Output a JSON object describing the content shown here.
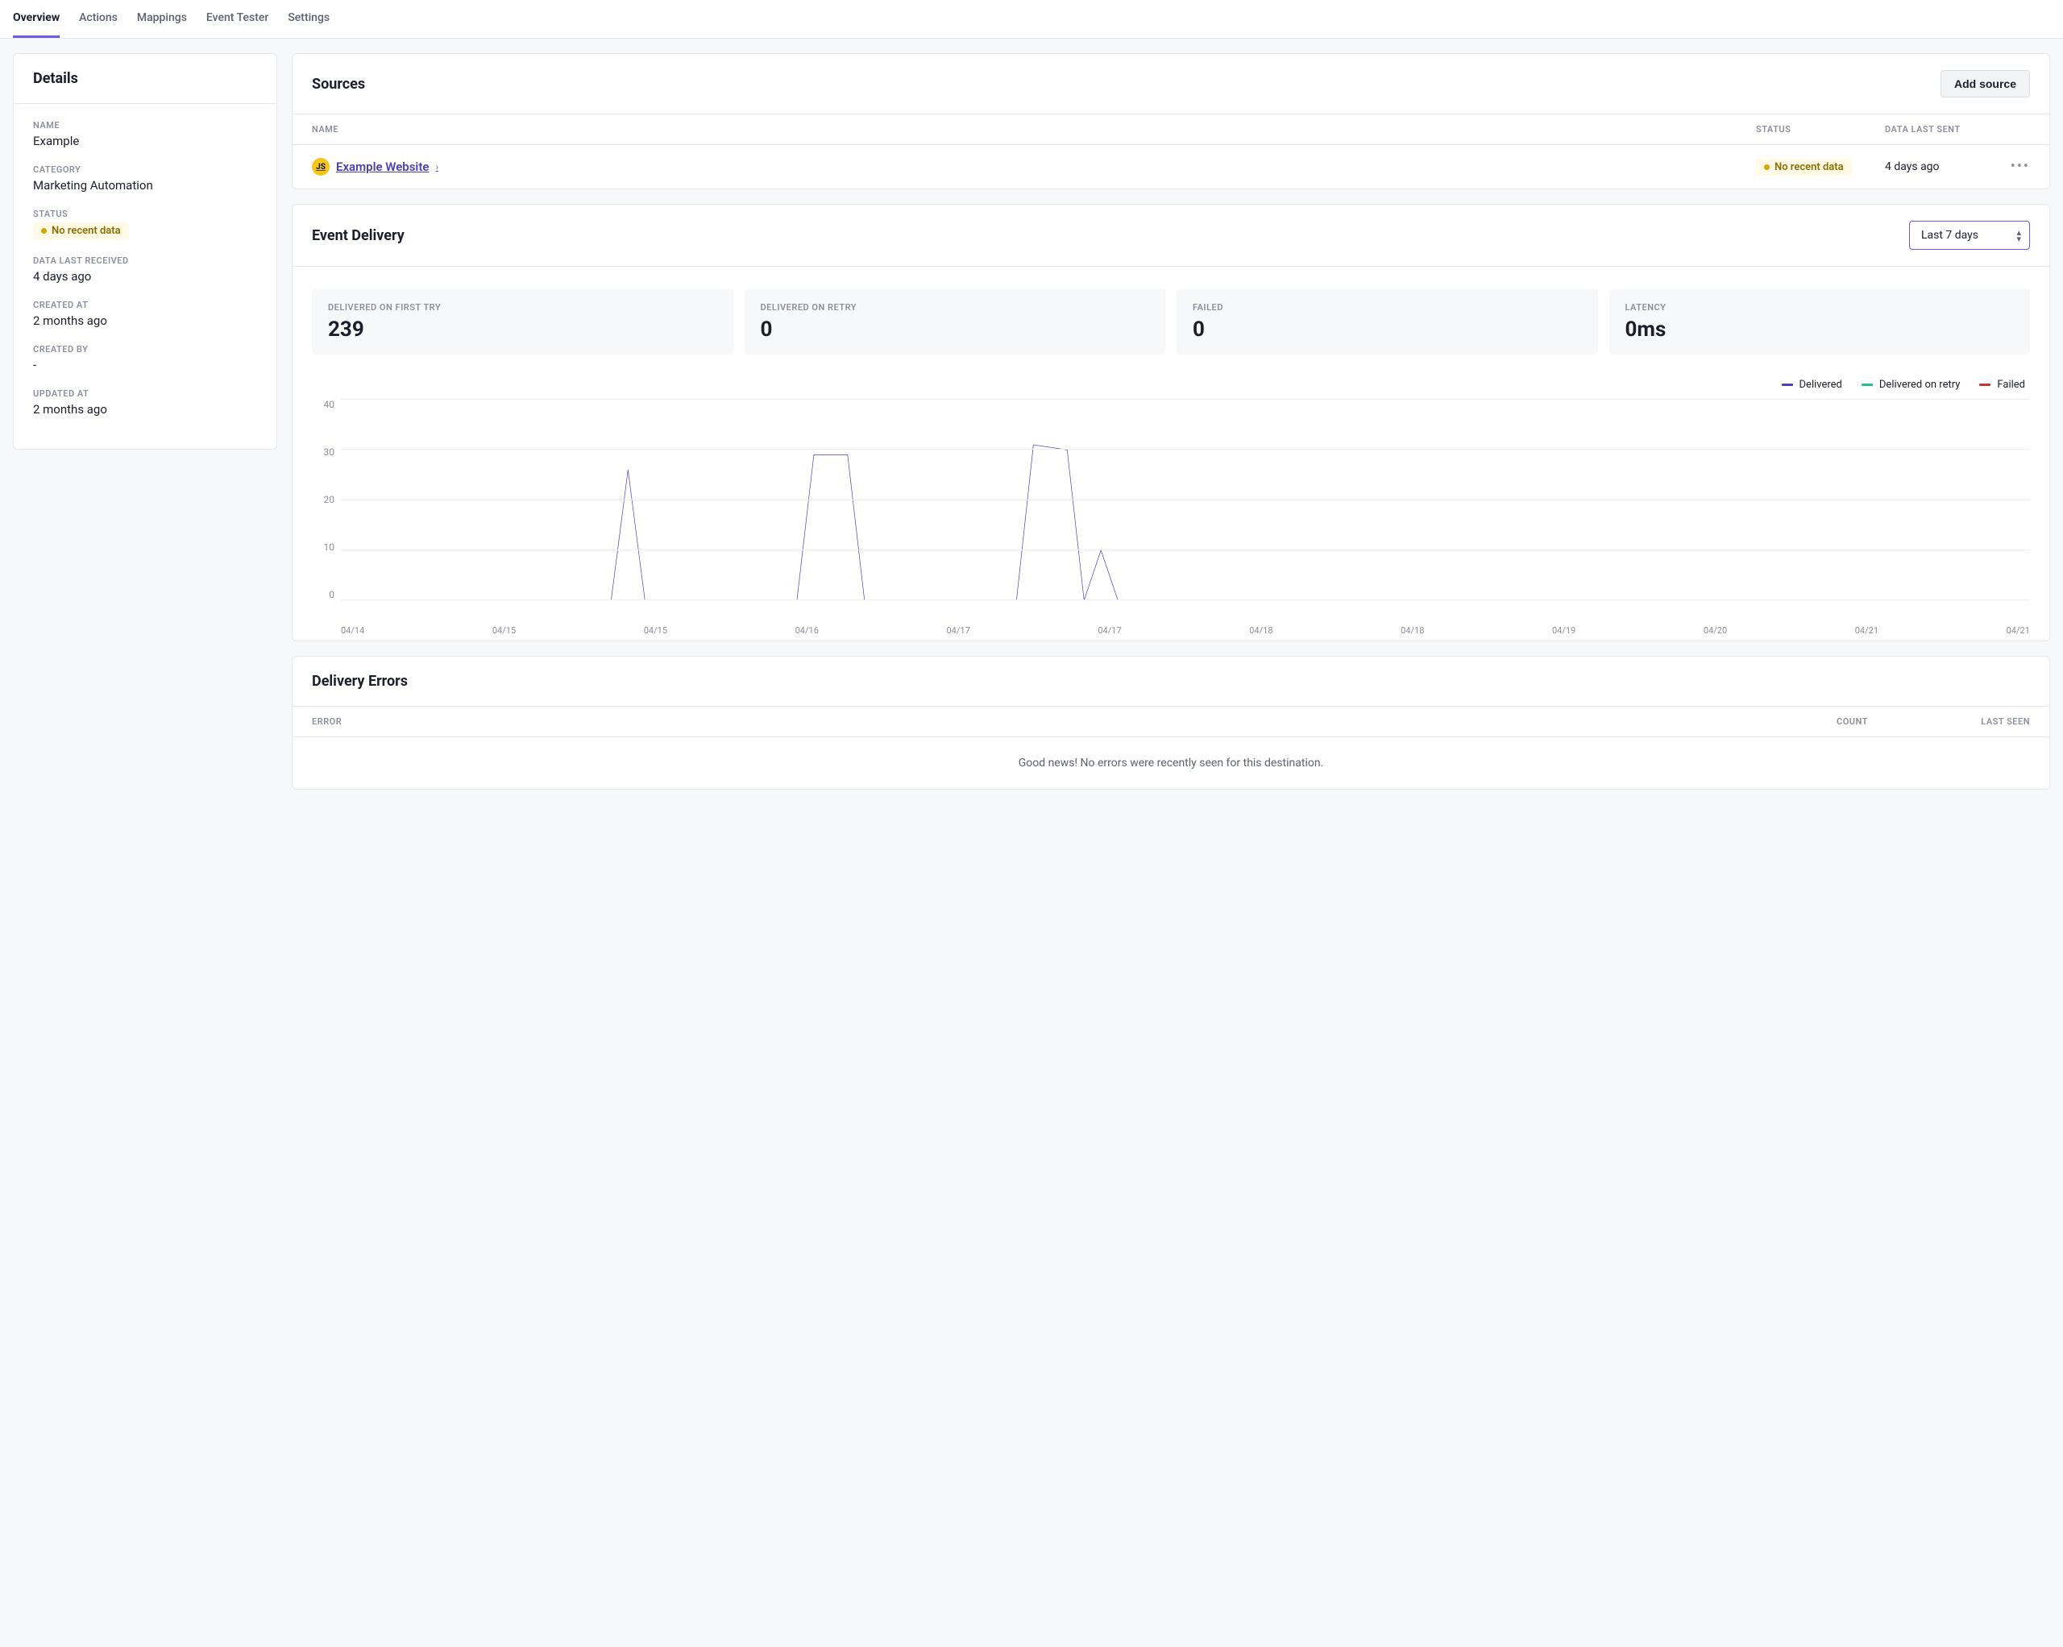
{
  "tabs": [
    "Overview",
    "Actions",
    "Mappings",
    "Event Tester",
    "Settings"
  ],
  "active_tab": 0,
  "details": {
    "title": "Details",
    "items": [
      {
        "label": "NAME",
        "value": "Example"
      },
      {
        "label": "CATEGORY",
        "value": "Marketing Automation"
      },
      {
        "label": "STATUS",
        "badge": "No recent data"
      },
      {
        "label": "DATA LAST RECEIVED",
        "value": "4 days ago"
      },
      {
        "label": "CREATED AT",
        "value": "2 months ago"
      },
      {
        "label": "CREATED BY",
        "value": "-"
      },
      {
        "label": "UPDATED AT",
        "value": "2 months ago"
      }
    ]
  },
  "sources": {
    "title": "Sources",
    "add_button": "Add source",
    "columns": [
      "NAME",
      "STATUS",
      "DATA LAST SENT"
    ],
    "rows": [
      {
        "icon": "JS",
        "name": "Example Website",
        "status_badge": "No recent data",
        "last": "4 days ago"
      }
    ]
  },
  "event_delivery": {
    "title": "Event Delivery",
    "range_selected": "Last 7 days",
    "stats": [
      {
        "label": "DELIVERED ON FIRST TRY",
        "value": "239"
      },
      {
        "label": "DELIVERED ON RETRY",
        "value": "0"
      },
      {
        "label": "FAILED",
        "value": "0"
      },
      {
        "label": "LATENCY",
        "value": "0ms"
      }
    ],
    "legend": [
      {
        "name": "Delivered",
        "color": "#4b3fb5"
      },
      {
        "name": "Delivered on retry",
        "color": "#1ec28b"
      },
      {
        "name": "Failed",
        "color": "#c0392b"
      }
    ]
  },
  "chart_data": {
    "type": "line",
    "title": "",
    "xlabel": "",
    "ylabel": "",
    "ylim": [
      0,
      40
    ],
    "y_ticks": [
      0,
      10,
      20,
      30,
      40
    ],
    "x_ticks": [
      "04/14",
      "04/15",
      "04/15",
      "04/16",
      "04/17",
      "04/17",
      "04/18",
      "04/18",
      "04/19",
      "04/20",
      "04/21",
      "04/21"
    ],
    "series": [
      {
        "name": "Delivered",
        "color": "#4b3fb5",
        "points": [
          [
            0,
            0
          ],
          [
            15,
            0
          ],
          [
            16,
            0
          ],
          [
            17,
            26
          ],
          [
            18,
            0
          ],
          [
            27,
            0
          ],
          [
            28,
            29
          ],
          [
            30,
            29
          ],
          [
            31,
            0
          ],
          [
            40,
            0
          ],
          [
            41,
            31
          ],
          [
            43,
            30
          ],
          [
            44,
            0
          ],
          [
            45,
            10
          ],
          [
            46,
            0
          ],
          [
            100,
            0
          ]
        ]
      },
      {
        "name": "Delivered on retry",
        "color": "#1ec28b",
        "points": [
          [
            0,
            0
          ],
          [
            100,
            0
          ]
        ]
      },
      {
        "name": "Failed",
        "color": "#c0392b",
        "points": [
          [
            0,
            0
          ],
          [
            100,
            0
          ]
        ]
      }
    ]
  },
  "delivery_errors": {
    "title": "Delivery Errors",
    "columns": [
      "ERROR",
      "COUNT",
      "LAST SEEN"
    ],
    "empty_message": "Good news! No errors were recently seen for this destination."
  }
}
